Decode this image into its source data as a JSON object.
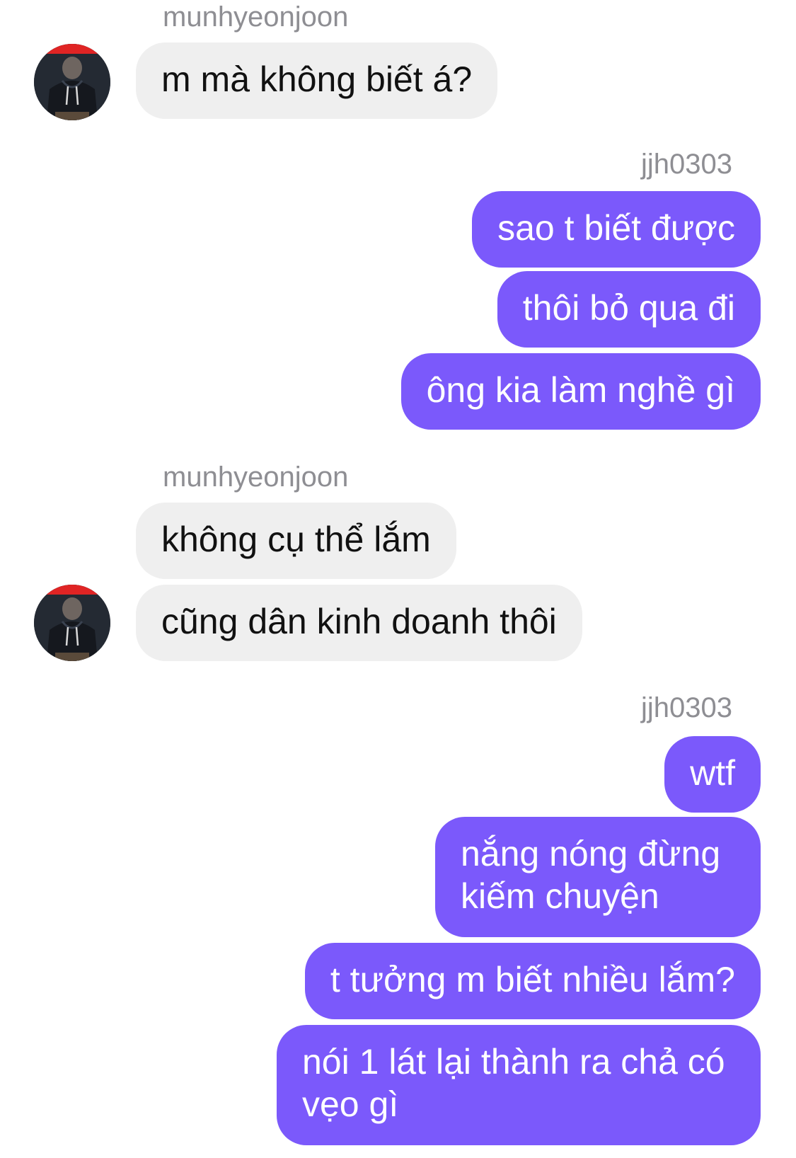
{
  "colors": {
    "incoming_bubble": "#efefef",
    "outgoing_bubble": "#7b59fb",
    "sender_name": "#8e8e93"
  },
  "groups": [
    {
      "sender": "munhyeonjoon",
      "direction": "incoming",
      "messages": [
        "m mà không biết á?"
      ]
    },
    {
      "sender": "jjh0303",
      "direction": "outgoing",
      "messages": [
        "sao t biết được",
        "thôi bỏ qua đi",
        "ông kia làm nghề gì"
      ]
    },
    {
      "sender": "munhyeonjoon",
      "direction": "incoming",
      "messages": [
        "không cụ thể lắm",
        "cũng dân kinh doanh thôi"
      ]
    },
    {
      "sender": "jjh0303",
      "direction": "outgoing",
      "messages": [
        "wtf",
        "nắng nóng đừng kiếm chuyện",
        "t tưởng m biết nhiều lắm?",
        "nói 1 lát lại thành ra chả có vẹo gì"
      ]
    }
  ],
  "avatar_icon": "user-avatar-hoodie"
}
